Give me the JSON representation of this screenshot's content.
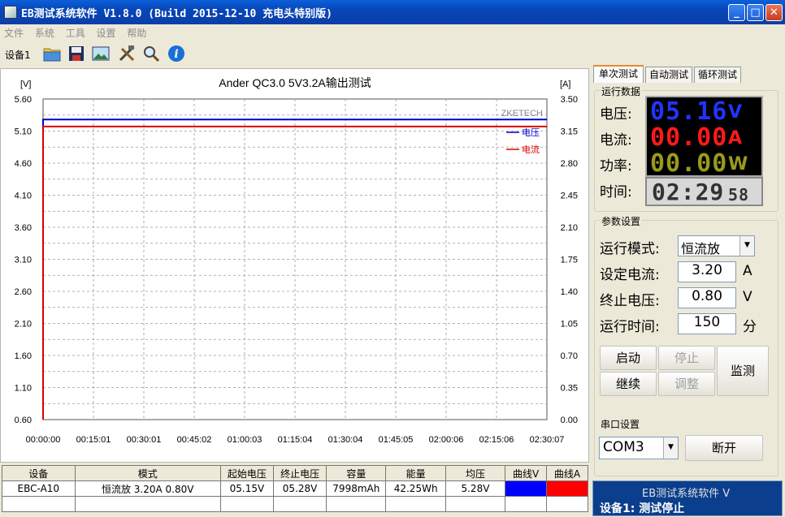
{
  "window": {
    "title": "EB测试系统软件 V1.8.0 (Build 2015-12-10 充电头特别版)",
    "minimize_glyph": "_",
    "maximize_glyph": "□",
    "close_glyph": "✕"
  },
  "menu": [
    "文件",
    "系统",
    "工具",
    "设置",
    "帮助"
  ],
  "toolbar": {
    "device_label": "设备1",
    "icons": [
      "folder-icon",
      "save-icon",
      "image-icon",
      "tools-icon",
      "search-icon",
      "info-icon"
    ]
  },
  "chart": {
    "title": "Ander QC3.0 5V3.2A输出测试",
    "left_unit": "[V]",
    "right_unit": "[A]",
    "watermark": "ZKETECH",
    "legend": [
      "电压",
      "电流"
    ]
  },
  "chart_data": {
    "type": "line",
    "title": "Ander QC3.0 5V3.2A输出测试",
    "x_ticks": [
      "00:00:00",
      "00:15:01",
      "00:30:01",
      "00:45:02",
      "01:00:03",
      "01:15:04",
      "01:30:04",
      "01:45:05",
      "02:00:06",
      "02:15:06",
      "02:30:07"
    ],
    "y_left_ticks": [
      "5.60",
      "5.10",
      "4.60",
      "4.10",
      "3.60",
      "3.10",
      "2.60",
      "2.10",
      "1.60",
      "1.10",
      "0.60"
    ],
    "y_right_ticks": [
      "3.50",
      "3.15",
      "2.80",
      "2.45",
      "2.10",
      "1.75",
      "1.40",
      "1.05",
      "0.70",
      "0.35",
      "0.00"
    ],
    "ylim_left": [
      0.6,
      5.6
    ],
    "ylim_right": [
      0.0,
      3.5
    ],
    "series": [
      {
        "name": "电压",
        "axis": "left",
        "color": "#0000cc",
        "x": [
          "00:00:00",
          "02:30:07"
        ],
        "values": [
          5.28,
          5.28
        ]
      },
      {
        "name": "电流",
        "axis": "right",
        "color": "#dd0000",
        "x": [
          "00:00:00",
          "02:30:07"
        ],
        "values": [
          3.2,
          3.2
        ]
      }
    ],
    "grid": true,
    "legend_position": "top-right"
  },
  "table": {
    "headers": [
      "设备",
      "模式",
      "起始电压",
      "终止电压",
      "容量",
      "能量",
      "均压",
      "曲线V",
      "曲线A"
    ],
    "row": {
      "device": "EBC-A10",
      "mode": "恒流放  3.20A  0.80V",
      "start_v": "05.15V",
      "end_v": "05.28V",
      "capacity": "7998mAh",
      "energy": "42.25Wh",
      "avg_v": "5.28V",
      "curve_v_color": "#0000ff",
      "curve_a_color": "#ff0000"
    }
  },
  "right": {
    "tabs": [
      "单次测试",
      "自动测试",
      "循环测试"
    ],
    "run_data": {
      "title": "运行数据",
      "voltage_label": "电压:",
      "voltage_value": "05.16",
      "voltage_unit": "V",
      "current_label": "电流:",
      "current_value": "00.00",
      "current_unit": "A",
      "power_label": "功率:",
      "power_value": "00.00",
      "power_unit": "W",
      "time_label": "时间:",
      "time_value": "02:29",
      "time_seconds": "58"
    },
    "params": {
      "title": "参数设置",
      "mode_label": "运行模式:",
      "mode_value": "恒流放",
      "current_label": "设定电流:",
      "current_value": "3.20",
      "current_unit": "A",
      "cutoff_label": "终止电压:",
      "cutoff_value": "0.80",
      "cutoff_unit": "V",
      "time_label": "运行时间:",
      "time_value": "150",
      "time_unit": "分"
    },
    "buttons": {
      "start": "启动",
      "stop": "停止",
      "continue": "继续",
      "adjust": "调整",
      "monitor": "监测"
    },
    "serial": {
      "title": "串口设置",
      "port": "COM3",
      "disconnect": "断开"
    },
    "status": {
      "line1": "EB测试系统软件 V",
      "line2": "设备1: 测试停止"
    }
  }
}
